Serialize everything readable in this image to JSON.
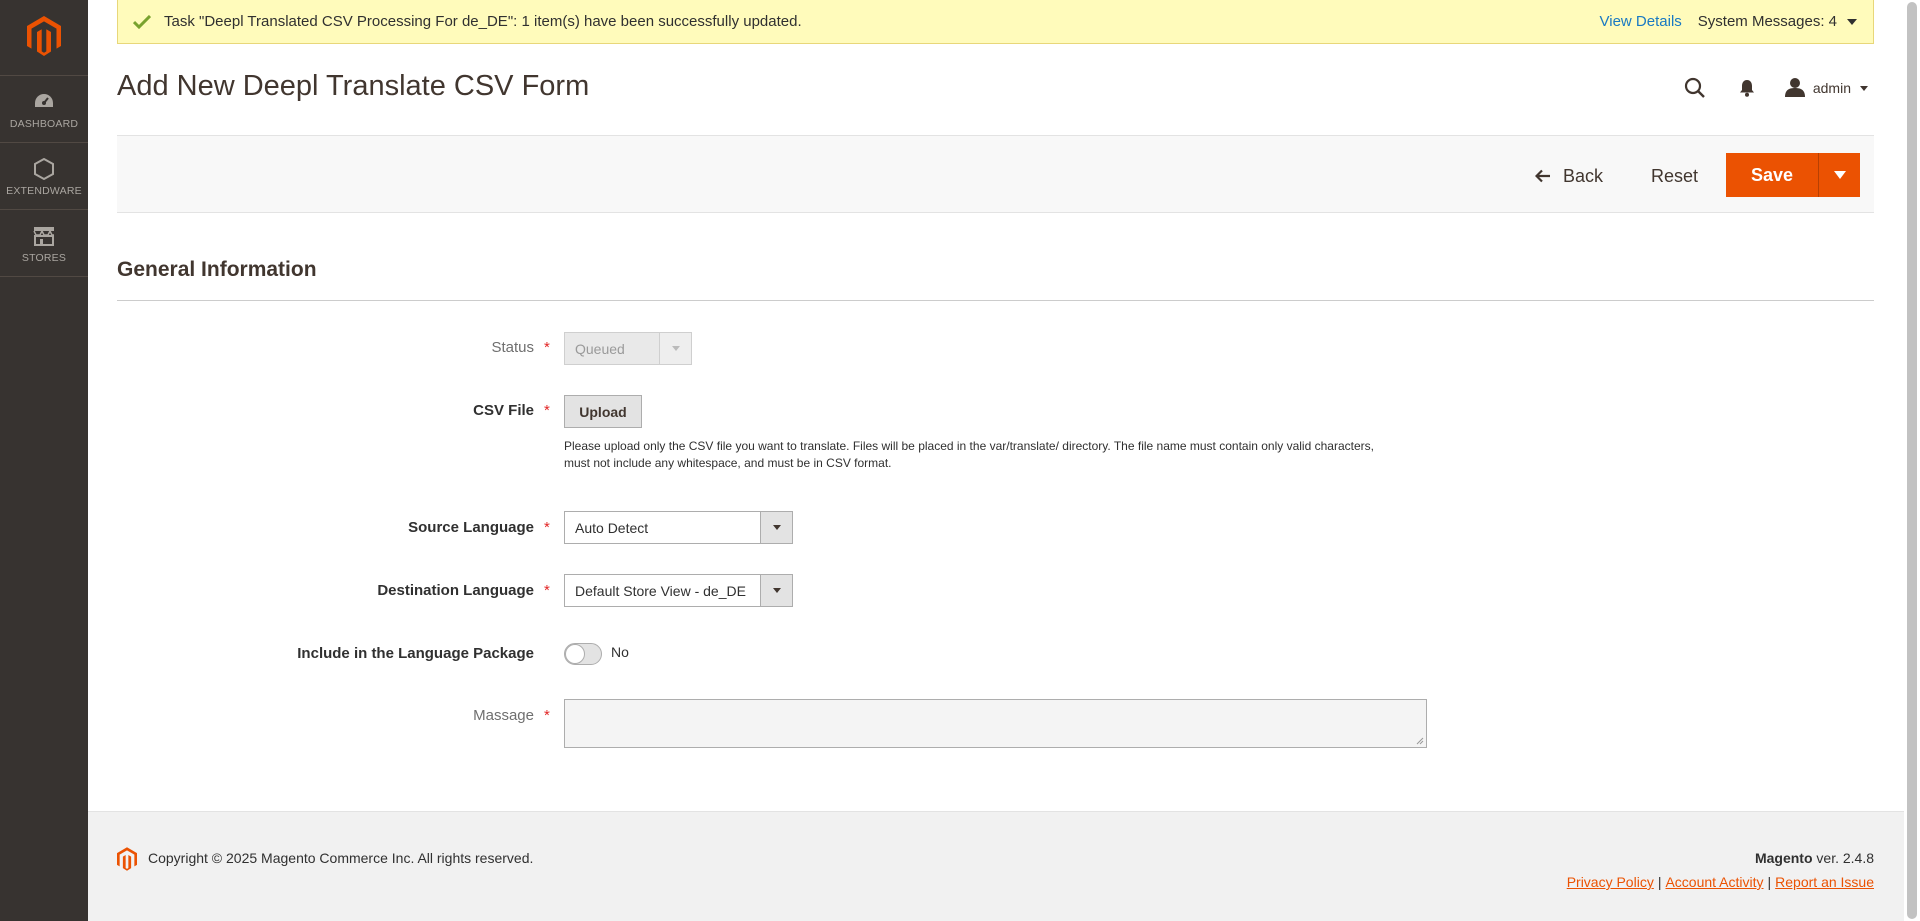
{
  "nav": {
    "logo": "magento-logo",
    "items": [
      {
        "label": "DASHBOARD",
        "icon": "speedometer-icon"
      },
      {
        "label": "EXTENDWARE",
        "icon": "hexagon-icon"
      },
      {
        "label": "STORES",
        "icon": "store-icon"
      }
    ]
  },
  "message": {
    "text": "Task \"Deepl Translated CSV Processing For de_DE\": 1 item(s) have been successfully updated.",
    "view_details": "View Details",
    "system_messages": "System Messages: 4"
  },
  "header": {
    "title": "Add New Deepl Translate CSV Form",
    "user": "admin"
  },
  "actions": {
    "back": "Back",
    "reset": "Reset",
    "save": "Save"
  },
  "section": {
    "title": "General Information"
  },
  "form": {
    "status": {
      "label": "Status",
      "value": "Queued"
    },
    "csv_file": {
      "label": "CSV File",
      "button": "Upload",
      "note_line1": "Please upload only the CSV file you want to translate. Files will be placed in the var/translate/ directory. The file name must contain only valid characters,",
      "note_line2": "must not include any whitespace, and must be in CSV format."
    },
    "source_language": {
      "label": "Source Language",
      "value": "Auto Detect"
    },
    "destination_language": {
      "label": "Destination Language",
      "value": "Default Store View - de_DE"
    },
    "include_package": {
      "label": "Include in the Language Package",
      "value": "No"
    },
    "massage": {
      "label": "Massage",
      "value": ""
    }
  },
  "footer": {
    "copyright": "Copyright © 2025 Magento Commerce Inc. All rights reserved.",
    "brand": "Magento",
    "version": " ver. 2.4.8",
    "links": [
      "Privacy Policy",
      "Account Activity",
      "Report an Issue"
    ],
    "separator": "|"
  },
  "colors": {
    "accent": "#eb5202",
    "nav_bg": "#373330",
    "message_bg": "#fffbbb",
    "link": "#1979c3"
  }
}
